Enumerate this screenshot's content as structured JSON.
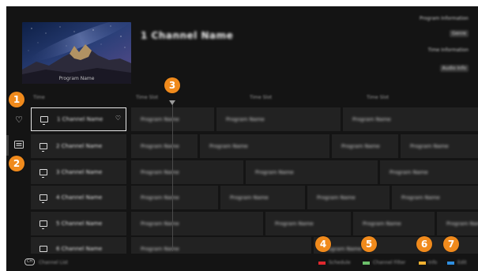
{
  "preview": {
    "caption": "Program Name"
  },
  "header": {
    "channel_title": "1 Channel Name",
    "info": [
      "Program Information",
      "Genre",
      "Time Information",
      "Audio Info"
    ]
  },
  "timeline": {
    "times": [
      "Time",
      "Time Slot",
      "Time Slot",
      "Time Slot"
    ]
  },
  "sidebar": {
    "favorite_icon": "heart-icon",
    "guide_icon": "epg-icon"
  },
  "channels": [
    {
      "name": "1 Channel Name",
      "focused": true,
      "favorite": true
    },
    {
      "name": "2 Channel Name"
    },
    {
      "name": "3 Channel Name"
    },
    {
      "name": "4 Channel Name"
    },
    {
      "name": "5 Channel Name"
    },
    {
      "name": "6 Channel Name"
    }
  ],
  "programs": [
    [
      "Program Name",
      "Program Name",
      "Program Name"
    ],
    [
      "Program Name",
      "Program Name",
      "Program Name",
      "Program Name"
    ],
    [
      "Program Name",
      "Program Name",
      "Program Name"
    ],
    [
      "Program Name",
      "Program Name",
      "Program Name",
      "Program Name"
    ],
    [
      "Program Name",
      "Program Name",
      "Program Name",
      "Program Name"
    ],
    [
      "Program Name",
      "Program Name"
    ]
  ],
  "bottom": {
    "key_icon": "ch-key-icon",
    "key_label": "Channel List",
    "color_keys": [
      {
        "color": "#e0282e",
        "label": "Schedule"
      },
      {
        "color": "#6bbf6a",
        "label": "Channel Filter"
      },
      {
        "color": "#f2b231",
        "label": "Info"
      },
      {
        "color": "#2f8fe0",
        "label": "Edit"
      }
    ]
  },
  "callouts": [
    "1",
    "2",
    "3",
    "4",
    "5",
    "6",
    "7"
  ],
  "colors": {
    "background": "#141414",
    "cell": "#222222",
    "callout": "#f08a1c"
  }
}
